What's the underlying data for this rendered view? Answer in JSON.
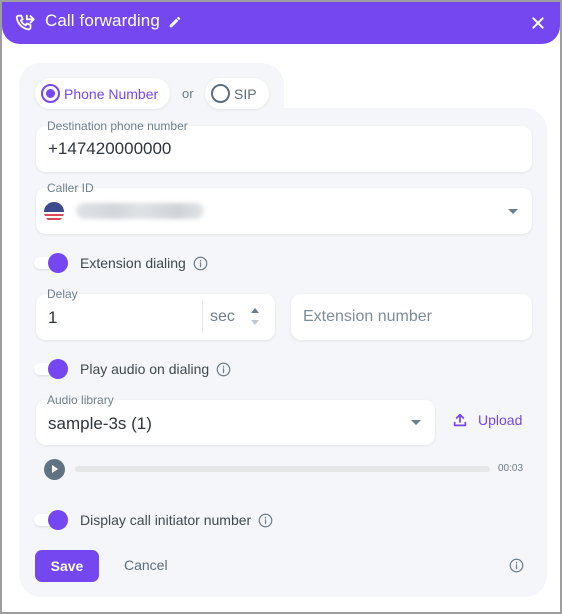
{
  "header": {
    "title": "Call forwarding",
    "icon": "phone-forward-icon",
    "accent_color": "#7447f0"
  },
  "destination_type": {
    "options": [
      {
        "label": "Phone Number",
        "selected": true
      },
      {
        "label": "SIP",
        "selected": false
      }
    ],
    "separator": "or"
  },
  "destination": {
    "label": "Destination phone number",
    "value": "+147420000000"
  },
  "caller_id": {
    "label": "Caller ID",
    "flag": "US",
    "value_obscured": true
  },
  "extension_dialing": {
    "label": "Extension dialing",
    "enabled": true,
    "delay": {
      "label": "Delay",
      "value": "1",
      "unit": "sec"
    },
    "extension_number": {
      "placeholder": "Extension number",
      "value": ""
    }
  },
  "play_audio": {
    "label": "Play audio on dialing",
    "enabled": true,
    "audio_library": {
      "label": "Audio library",
      "value": "sample-3s (1)"
    },
    "upload_label": "Upload",
    "player": {
      "duration": "00:03",
      "progress_percent": 0
    }
  },
  "display_initiator": {
    "label": "Display call initiator number",
    "enabled": true
  },
  "footer": {
    "save_label": "Save",
    "cancel_label": "Cancel"
  }
}
